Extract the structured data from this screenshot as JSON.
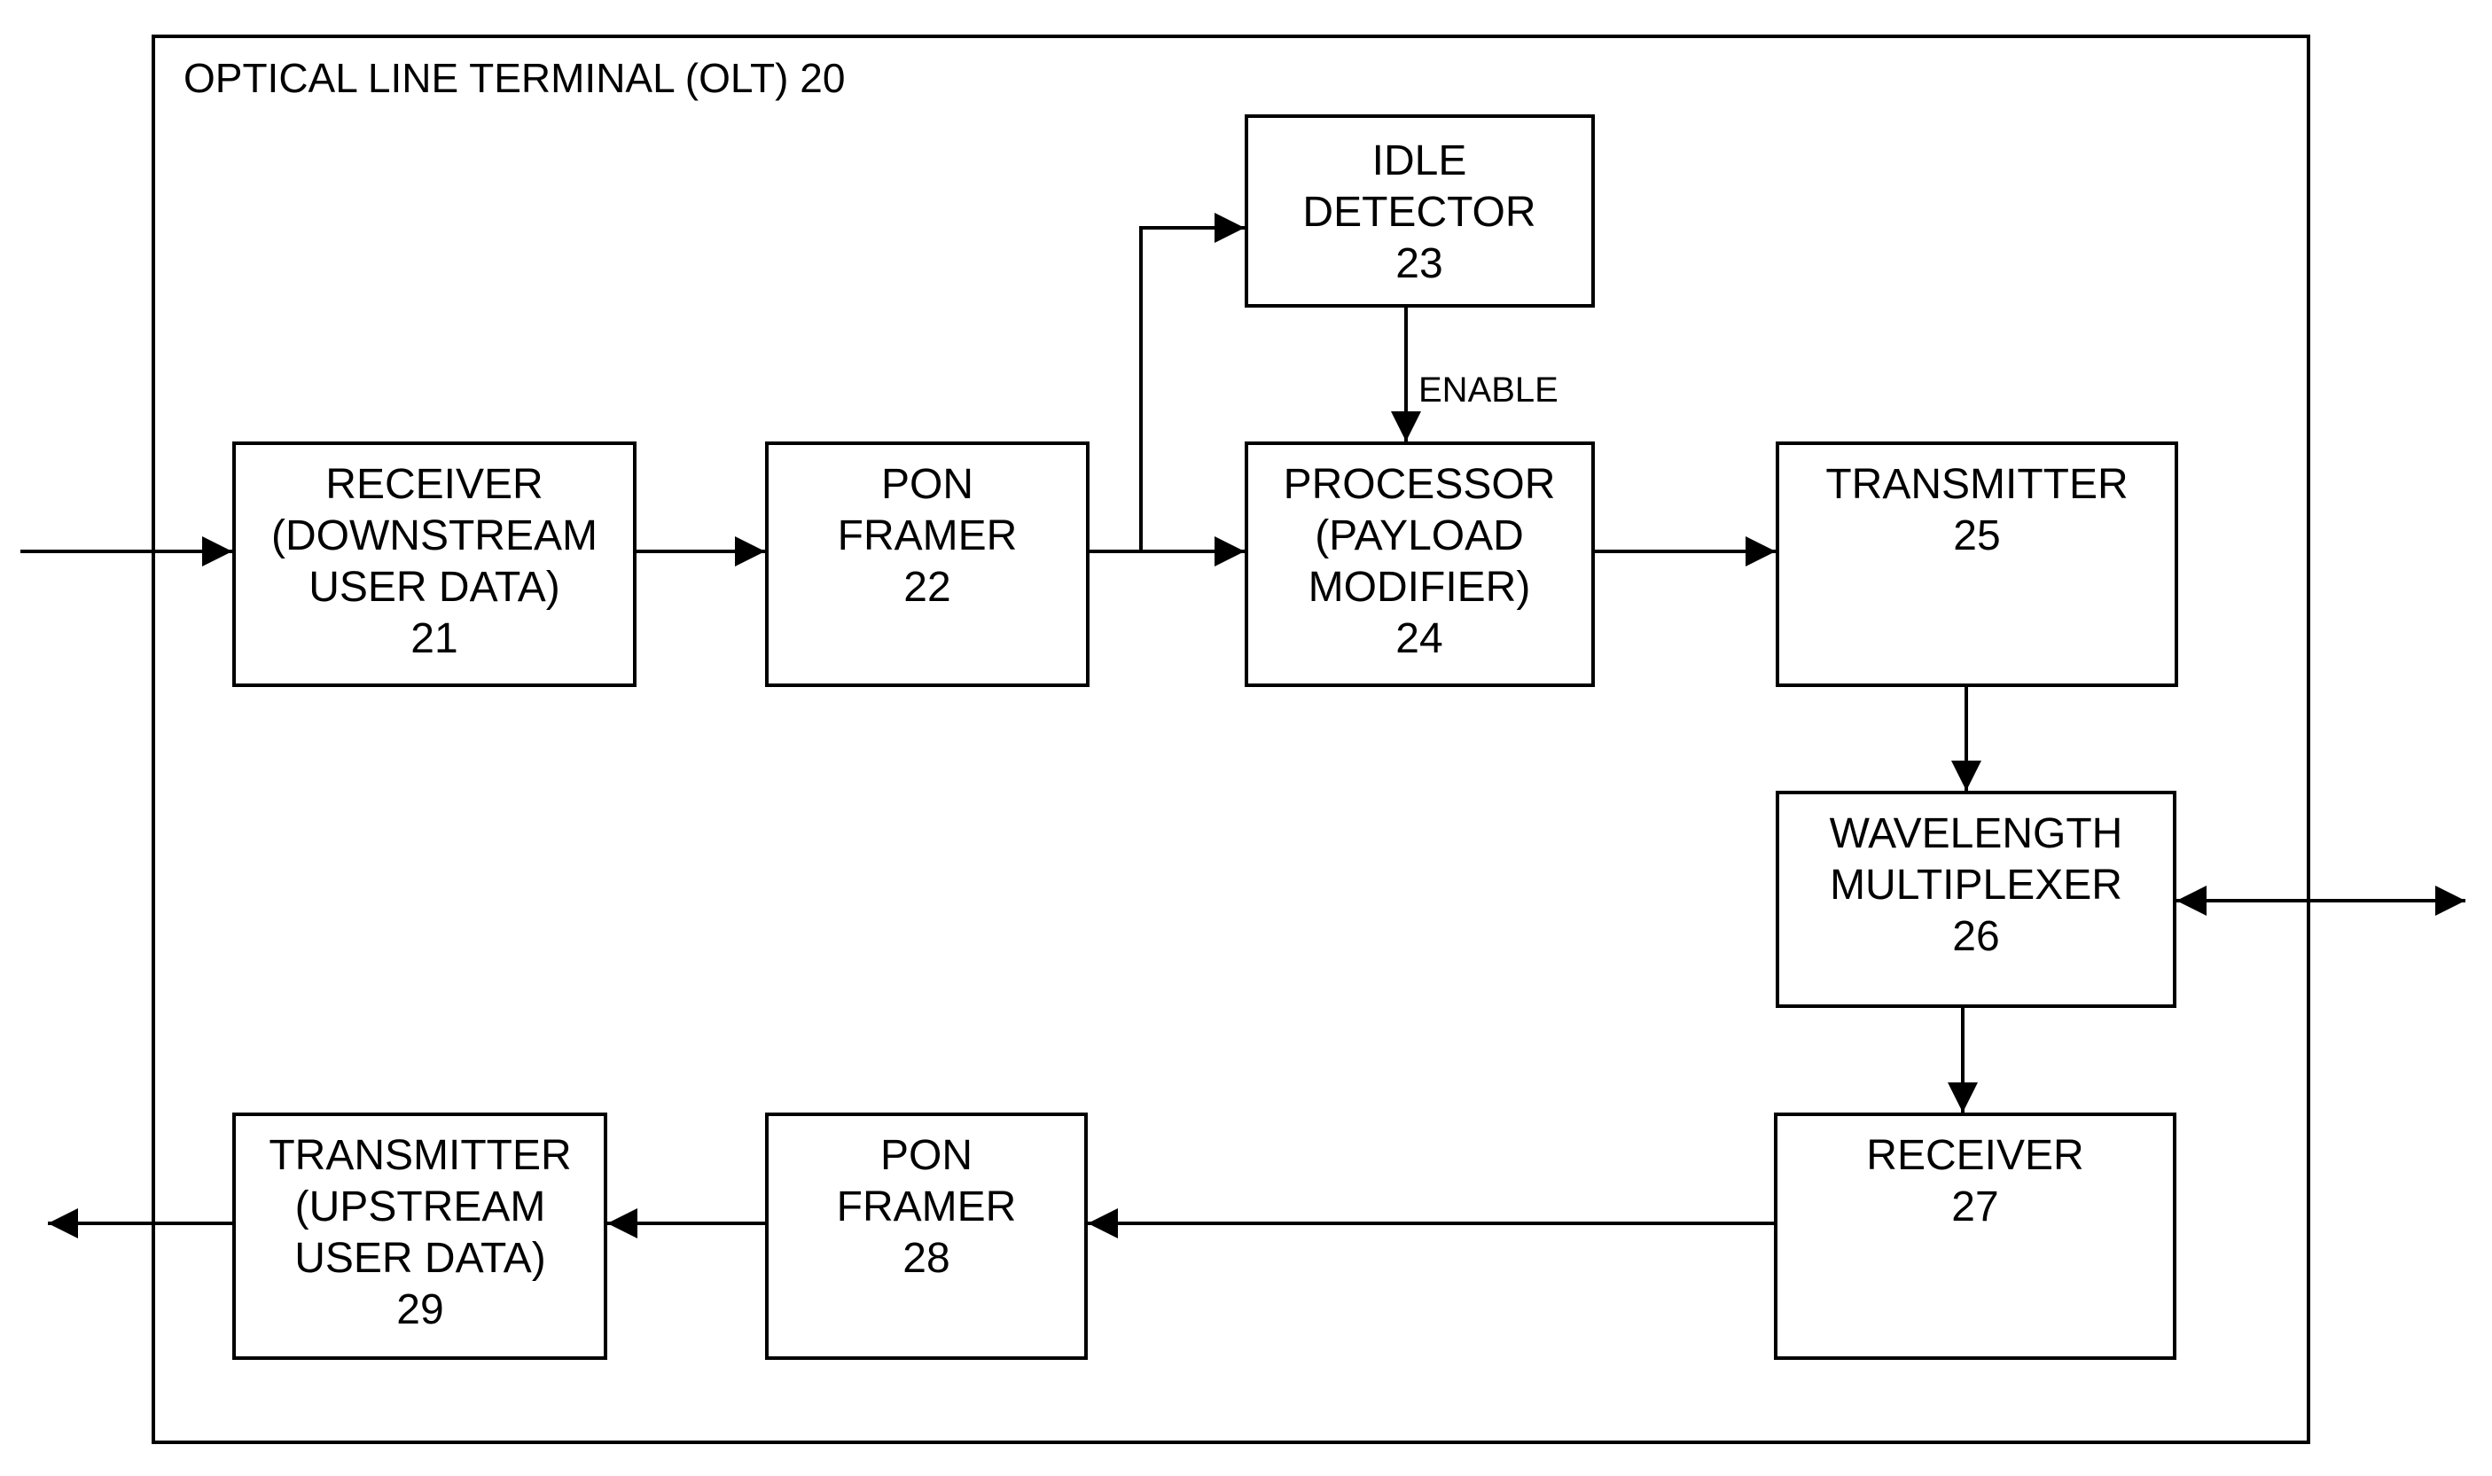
{
  "title": "OPTICAL LINE TERMINAL (OLT) 20",
  "blocks": {
    "receiver_downstream": {
      "lines": [
        "RECEIVER",
        "(DOWNSTREAM",
        "USER DATA)",
        "21"
      ]
    },
    "pon_framer_22": {
      "lines": [
        "PON",
        "FRAMER",
        "22"
      ]
    },
    "idle_detector": {
      "lines": [
        "IDLE",
        "DETECTOR",
        "23"
      ]
    },
    "processor": {
      "lines": [
        "PROCESSOR",
        "(PAYLOAD",
        "MODIFIER)",
        "24"
      ]
    },
    "transmitter_25": {
      "lines": [
        "TRANSMITTER",
        "25"
      ]
    },
    "wavelength_multiplexer": {
      "lines": [
        "WAVELENGTH",
        "MULTIPLEXER",
        "26"
      ]
    },
    "receiver_27": {
      "lines": [
        "RECEIVER",
        "27"
      ]
    },
    "pon_framer_28": {
      "lines": [
        "PON",
        "FRAMER",
        "28"
      ]
    },
    "transmitter_upstream": {
      "lines": [
        "TRANSMITTER",
        "(UPSTREAM",
        "USER DATA)",
        "29"
      ]
    }
  },
  "signals": {
    "enable": "ENABLE"
  },
  "colors": {
    "line": "#000000",
    "background": "#ffffff"
  }
}
